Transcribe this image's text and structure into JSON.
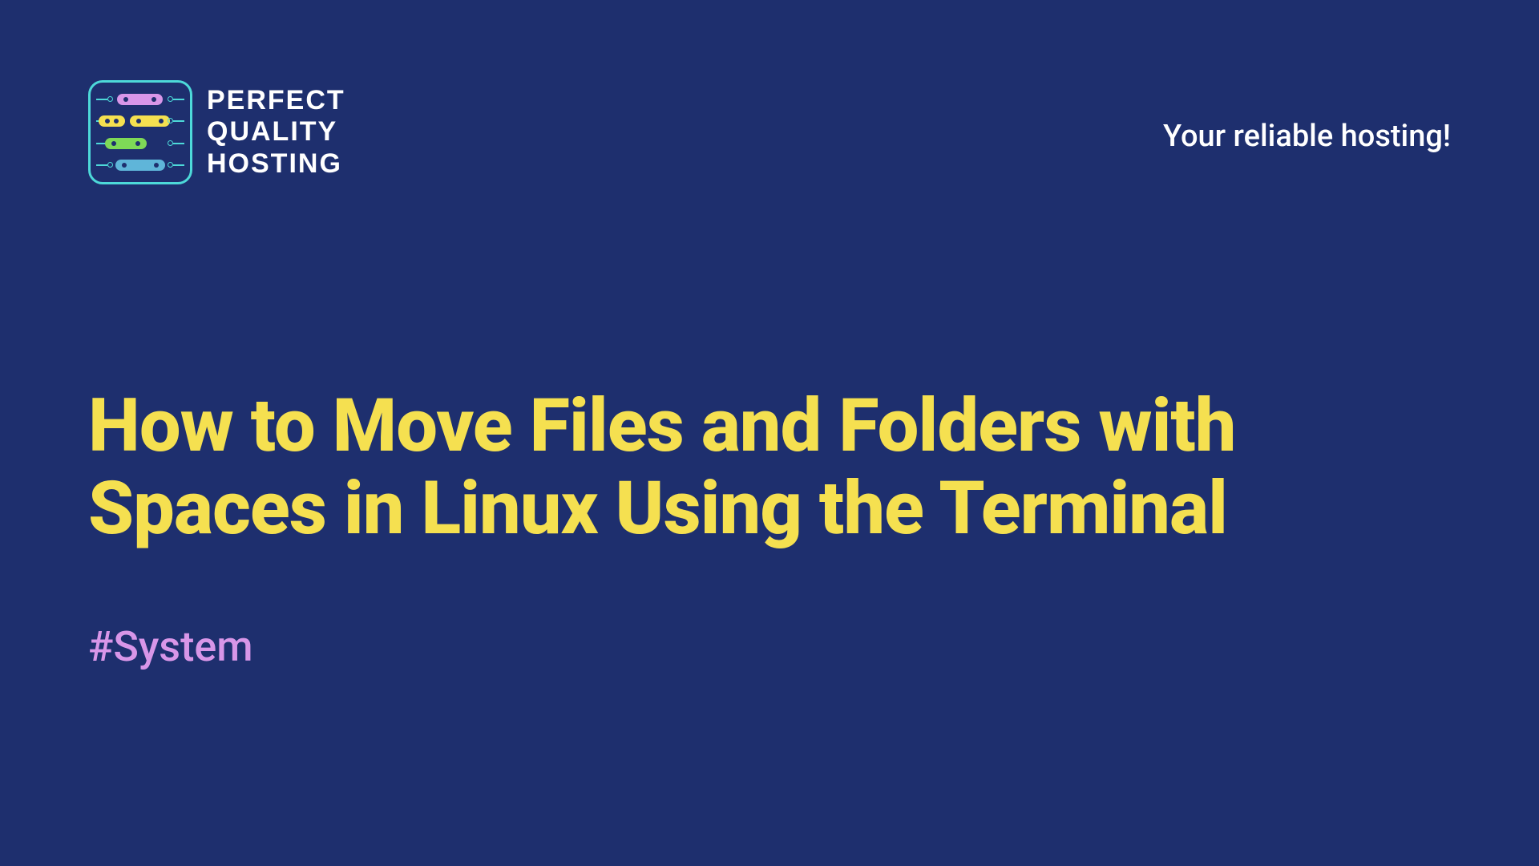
{
  "logo": {
    "line1": "PERFECT",
    "line2": "QUALITY",
    "line3": "HOSTING"
  },
  "tagline": "Your reliable hosting!",
  "title": "How to Move Files and Folders with Spaces in Linux Using the Terminal",
  "hashtag": "#System"
}
